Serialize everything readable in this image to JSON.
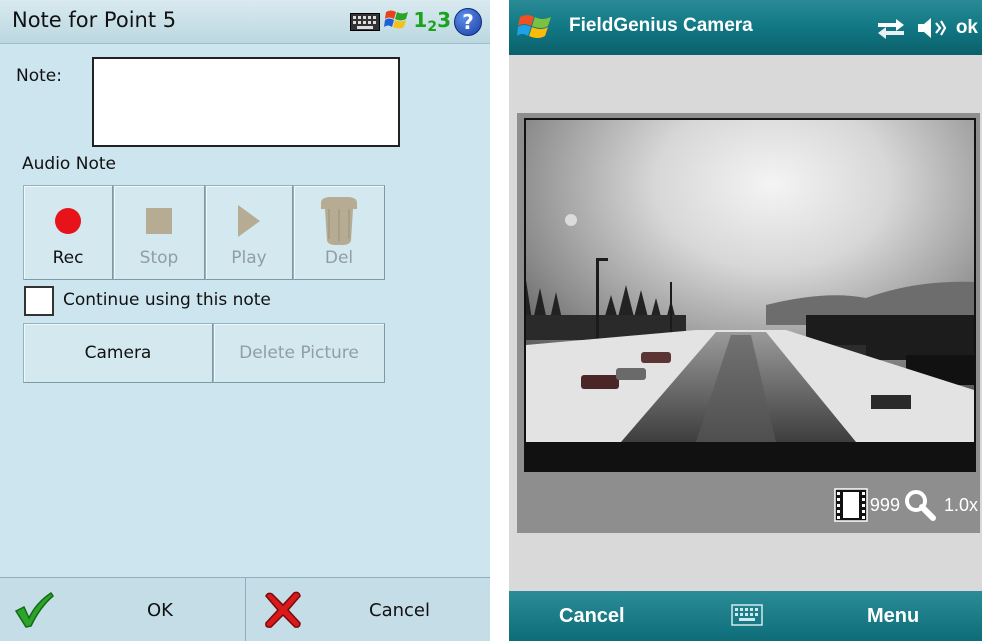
{
  "left": {
    "title": "Note for Point 5",
    "note_label": "Note:",
    "note_value": "",
    "audio_label": "Audio Note",
    "audio_buttons": [
      {
        "label": "Rec",
        "icon": "record-icon",
        "enabled": true
      },
      {
        "label": "Stop",
        "icon": "stop-icon",
        "enabled": false
      },
      {
        "label": "Play",
        "icon": "play-icon",
        "enabled": false
      },
      {
        "label": "Del",
        "icon": "delete-icon",
        "enabled": false
      }
    ],
    "continue_label": "Continue using this note",
    "continue_checked": false,
    "camera_label": "Camera",
    "delete_picture_label": "Delete Picture",
    "ok_label": "OK",
    "cancel_label": "Cancel",
    "system_icons": [
      "keyboard-icon",
      "windows-flag-icon",
      "123-input-icon",
      "help-icon"
    ],
    "input_mode": "1",
    "input_mode_sub": "2",
    "input_mode_tail": "3",
    "help_glyph": "?"
  },
  "right": {
    "title": "FieldGenius Camera",
    "ok_label": "ok",
    "counter": "999",
    "zoom": "1.0x",
    "cancel_label": "Cancel",
    "menu_label": "Menu",
    "system_icons": [
      "connectivity-icon",
      "speaker-mute-icon"
    ]
  },
  "colors": {
    "left_bg": "#cde5ee",
    "accent_teal": "#127a86",
    "rec_red": "#e8121b",
    "check_green": "#2aa52a",
    "cancel_red": "#d81a1a"
  }
}
